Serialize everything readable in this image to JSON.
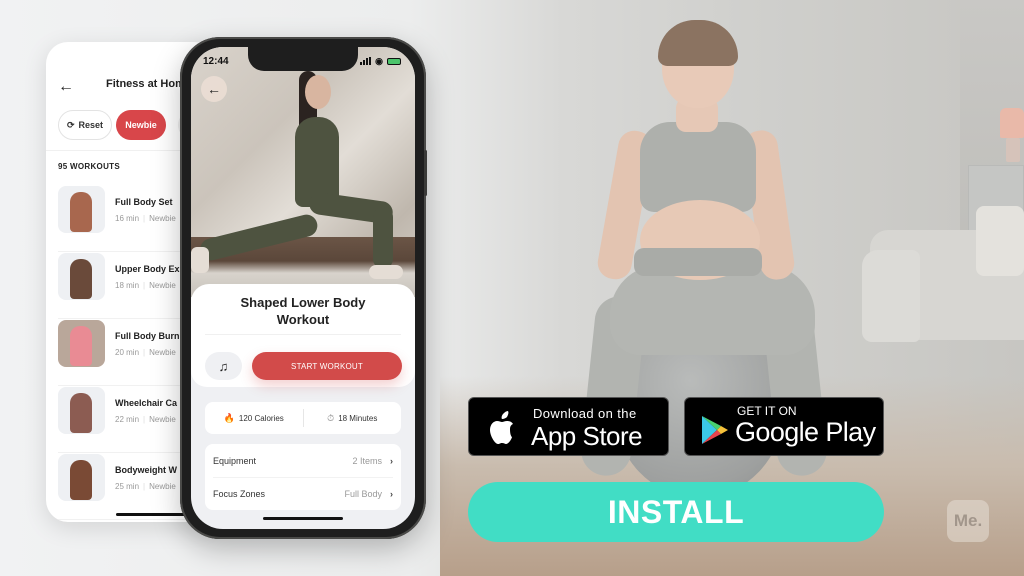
{
  "back_screen": {
    "title": "Fitness at Home",
    "filters": [
      {
        "label": "Reset",
        "icon": "refresh-icon",
        "active": false
      },
      {
        "label": "Newbie",
        "active": true
      }
    ],
    "workout_count": "95 WORKOUTS",
    "workouts": [
      {
        "name": "Full Body Set",
        "duration": "16 min",
        "level": "Newbie"
      },
      {
        "name": "Upper Body Ex",
        "duration": "18 min",
        "level": "Newbie"
      },
      {
        "name": "Full Body Burn",
        "duration": "20 min",
        "level": "Newbie"
      },
      {
        "name": "Wheelchair Ca",
        "duration": "22 min",
        "level": "Newbie"
      },
      {
        "name": "Bodyweight W",
        "duration": "25 min",
        "level": "Newbie"
      }
    ]
  },
  "front_screen": {
    "status_time": "12:44",
    "workout_title": "Shaped Lower Body Workout",
    "start_label": "START WORKOUT",
    "stats": {
      "calories": "120 Calories",
      "duration": "18 Minutes"
    },
    "details": [
      {
        "label": "Equipment",
        "value": "2 Items"
      },
      {
        "label": "Focus Zones",
        "value": "Full Body"
      }
    ]
  },
  "store": {
    "apple_small": "Download on the",
    "apple_big": "App Store",
    "google_small": "GET IT ON",
    "google_big": "Google Play"
  },
  "cta": {
    "install_label": "INSTALL"
  },
  "brand": {
    "logo_text": "Me."
  },
  "colors": {
    "accent_red": "#d24b4a",
    "install_teal": "#41ddc5"
  }
}
